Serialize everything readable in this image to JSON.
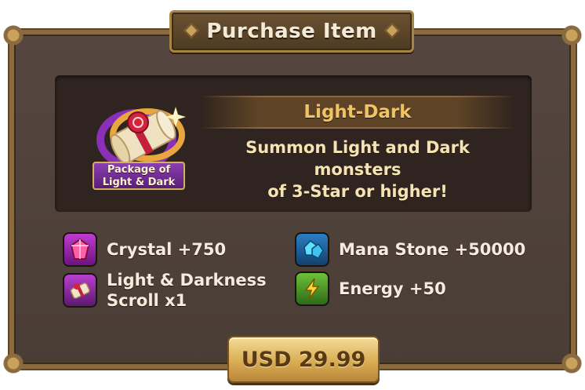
{
  "dialog": {
    "title": "Purchase Item"
  },
  "item": {
    "name": "Light-Dark",
    "icon_label_line1": "Package of",
    "icon_label_line2": "Light & Dark",
    "description_line1": "Summon Light and Dark monsters",
    "description_line2": "of 3-Star or higher!"
  },
  "rewards": [
    {
      "label": "Crystal +750",
      "icon": "crystal-icon"
    },
    {
      "label": "Mana Stone +50000",
      "icon": "mana-stone-icon"
    },
    {
      "label_line1": "Light & Darkness",
      "label_line2": "Scroll x1",
      "icon": "light-darkness-scroll-icon"
    },
    {
      "label": "Energy +50",
      "icon": "energy-icon"
    }
  ],
  "purchase": {
    "price_label": "USD 29.99"
  },
  "colors": {
    "frame": "#55473f",
    "gold": "#c9a25c",
    "name_text": "#f0c465",
    "desc_text": "#f6e3b4"
  }
}
